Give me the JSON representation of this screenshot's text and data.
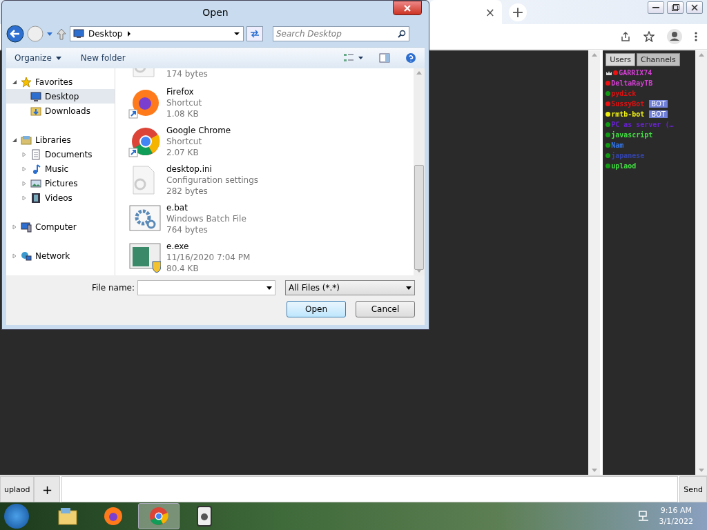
{
  "browser": {
    "close_tab_glyph": "×",
    "new_tab_glyph": "+"
  },
  "users_panel": {
    "tabs": [
      {
        "label": "Users",
        "selected": true
      },
      {
        "label": "Channels",
        "selected": false
      }
    ],
    "users": [
      {
        "name": {
          "text": "GARRIX74",
          "color": "#d040d0"
        },
        "color": "#ee1111",
        "owner": true
      },
      {
        "name": {
          "text": "DeltaRayTB",
          "color": "#d040d0"
        },
        "color": "#ee1111"
      },
      {
        "name": {
          "text": "pydick",
          "color": "#dd1111"
        },
        "color": "#119911"
      },
      {
        "name": {
          "text": "SussyBot",
          "color": "#dd1111"
        },
        "color": "#ee1111",
        "badge": "BOT"
      },
      {
        "name": {
          "text": "rmtb-bot",
          "color": "#eeee11"
        },
        "color": "#eeee11",
        "badge": "BOT"
      },
      {
        "name": {
          "text": "PC as server (…",
          "color": "#6622cc"
        },
        "color": "#119911"
      },
      {
        "name": {
          "text": "javascript",
          "color": "#44dd44"
        },
        "color": "#119911"
      },
      {
        "name": {
          "text": "Nam",
          "color": "#3377ee"
        },
        "color": "#119911"
      },
      {
        "name": {
          "text": "japanese",
          "color": "#3344aa"
        },
        "color": "#119911"
      },
      {
        "name": {
          "text": "uplaod",
          "color": "#44dd44"
        },
        "color": "#119911"
      }
    ]
  },
  "chat_input": {
    "channel_button": "uplaod",
    "add_button": "+",
    "send_button": "Send"
  },
  "dialog": {
    "title": "Open",
    "address": "Desktop",
    "search_placeholder": "Search Desktop",
    "commands": [
      "Organize",
      "New folder"
    ],
    "nav": [
      {
        "label": "Favorites",
        "kind": "star",
        "expanded": true,
        "selected": false,
        "children": [
          {
            "label": "Desktop",
            "kind": "desktop",
            "selected": true
          },
          {
            "label": "Downloads",
            "kind": "downloads",
            "selected": false
          }
        ]
      },
      {
        "label": "Libraries",
        "kind": "library",
        "expanded": true,
        "selected": false,
        "children": [
          {
            "label": "Documents",
            "kind": "document",
            "expanded": false,
            "selected": false
          },
          {
            "label": "Music",
            "kind": "music",
            "expanded": false,
            "selected": false
          },
          {
            "label": "Pictures",
            "kind": "picture",
            "expanded": false,
            "selected": false
          },
          {
            "label": "Videos",
            "kind": "video",
            "expanded": false,
            "selected": false
          }
        ]
      },
      {
        "label": "Computer",
        "kind": "computer",
        "expanded": false,
        "selected": false
      },
      {
        "label": "Network",
        "kind": "network",
        "expanded": false,
        "selected": false
      }
    ],
    "files": [
      {
        "kind": "settings-file",
        "lines": [
          "174 bytes"
        ]
      },
      {
        "kind": "firefox",
        "lines": [
          "Firefox",
          "Shortcut",
          "1.08 KB"
        ]
      },
      {
        "kind": "chrome",
        "lines": [
          "Google Chrome",
          "Shortcut",
          "2.07 KB"
        ]
      },
      {
        "kind": "settings-file",
        "lines": [
          "desktop.ini",
          "Configuration settings",
          "282 bytes"
        ]
      },
      {
        "kind": "batch",
        "lines": [
          "e.bat",
          "Windows Batch File",
          "764 bytes"
        ]
      },
      {
        "kind": "exe",
        "lines": [
          "e.exe",
          "11/16/2020 7:04 PM",
          "80.4 KB"
        ]
      }
    ],
    "file_name_label": "File name:",
    "file_type": "All Files (*.*)",
    "buttons": [
      "Open",
      "Cancel"
    ]
  },
  "taskbar": {
    "items": [
      {
        "kind": "explorer",
        "active": false
      },
      {
        "kind": "firefox",
        "active": false
      },
      {
        "kind": "chrome",
        "active": true
      },
      {
        "kind": "app",
        "active": false
      }
    ],
    "time": "9:16 AM",
    "date": "3/1/2022"
  }
}
